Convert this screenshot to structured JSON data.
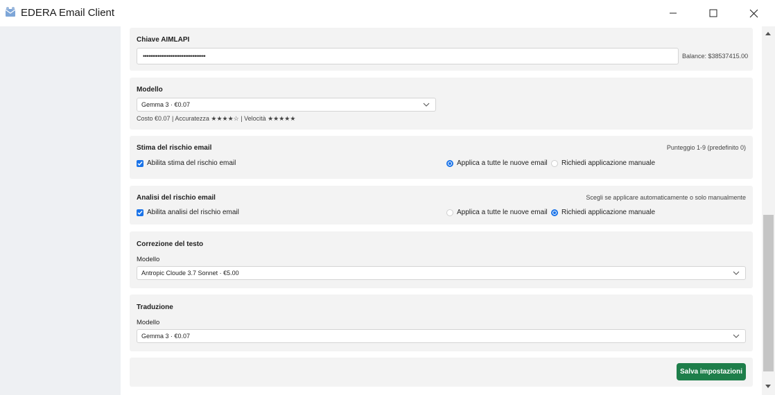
{
  "window": {
    "title": "EDERA Email Client",
    "controls": [
      "minimize",
      "maximize",
      "close"
    ]
  },
  "api_key": {
    "title": "Chiave AIMLAPI",
    "value": "••••••••••••••••••••••••••••••••••",
    "balance": "Balance: $38537415.00"
  },
  "model": {
    "title": "Modello",
    "selected": "Gemma 3 · €0.07",
    "info": "Costo €0.07 | Accuratezza ★★★★☆ | Velocità ★★★★★"
  },
  "risk_estimation": {
    "title": "Stima del rischio email",
    "hint": "Punteggio 1-9 (predefinito 0)",
    "checkbox_label": "Abilita stima del rischio email",
    "checked": true,
    "option_auto": "Applica a tutte le nuove email",
    "option_manual": "Richiedi applicazione manuale",
    "selected": "auto"
  },
  "risk_analysis": {
    "title": "Analisi del rischio email",
    "hint": "Scegli se applicare automaticamente o solo manualmente",
    "checkbox_label": "Abilita analisi del rischio email",
    "checked": true,
    "option_auto": "Applica a tutte le nuove email",
    "option_manual": "Richiedi applicazione manuale",
    "selected": "manual"
  },
  "text_correction": {
    "title": "Correzione del testo",
    "model_label": "Modello",
    "selected": "Antropic Cloude 3.7 Sonnet · €5.00"
  },
  "translation": {
    "title": "Traduzione",
    "model_label": "Modello",
    "selected": "Gemma 3 · €0.07"
  },
  "actions": {
    "save_label": "Salva impostazioni"
  },
  "colors": {
    "accent": "#1a73e8",
    "save_button": "#1e7e4a",
    "card_bg": "#f3f3f3",
    "sidebar_bg": "#eef0f3"
  }
}
